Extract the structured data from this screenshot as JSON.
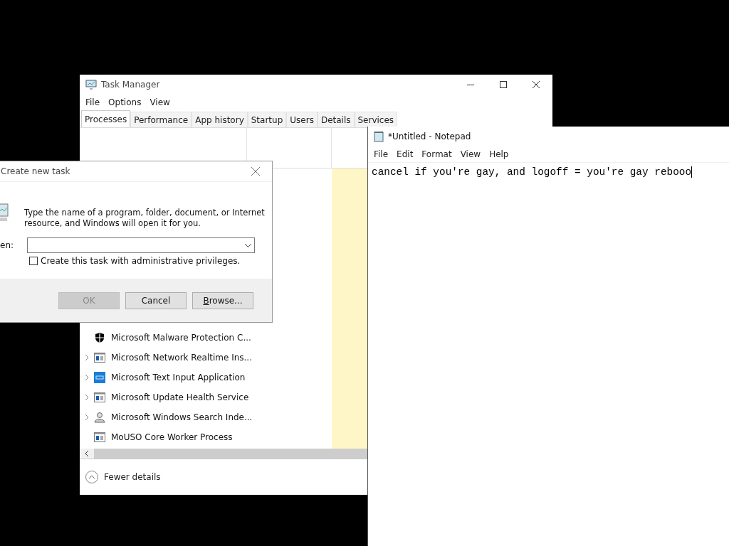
{
  "task_manager": {
    "title": "Task Manager",
    "menu": [
      "File",
      "Options",
      "View"
    ],
    "tabs": [
      {
        "label": "Processes",
        "selected": true
      },
      {
        "label": "Performance",
        "selected": false
      },
      {
        "label": "App history",
        "selected": false
      },
      {
        "label": "Startup",
        "selected": false
      },
      {
        "label": "Users",
        "selected": false
      },
      {
        "label": "Details",
        "selected": false
      },
      {
        "label": "Services",
        "selected": false
      }
    ],
    "rows": [
      {
        "name": "Microsoft Malware Protection C...",
        "kind": "shield",
        "expandable": false
      },
      {
        "name": "Microsoft Network Realtime Ins...",
        "kind": "service",
        "expandable": true
      },
      {
        "name": "Microsoft Text Input Application",
        "kind": "input",
        "expandable": true
      },
      {
        "name": "Microsoft Update Health Service",
        "kind": "service",
        "expandable": true
      },
      {
        "name": "Microsoft Windows Search Inde...",
        "kind": "user",
        "expandable": true
      },
      {
        "name": "MoUSO Core Worker Process",
        "kind": "service",
        "expandable": false
      }
    ],
    "footer": "Fewer details"
  },
  "run_dialog": {
    "title": "Create new task",
    "description": "Type the name of a program, folder, document, or Internet resource, and Windows will open it for you.",
    "open_label": "en:",
    "admin_checkbox": {
      "label": "Create this task with administrative privileges.",
      "checked": false
    },
    "buttons": [
      {
        "label": "OK",
        "disabled": true
      },
      {
        "label": "Cancel",
        "disabled": false
      },
      {
        "label": "Browse...",
        "disabled": false
      }
    ]
  },
  "notepad": {
    "title": "*Untitled - Notepad",
    "menu": [
      "File",
      "Edit",
      "Format",
      "View",
      "Help"
    ],
    "content": "cancel if you're gay, and logoff = you're gay rebooo"
  }
}
